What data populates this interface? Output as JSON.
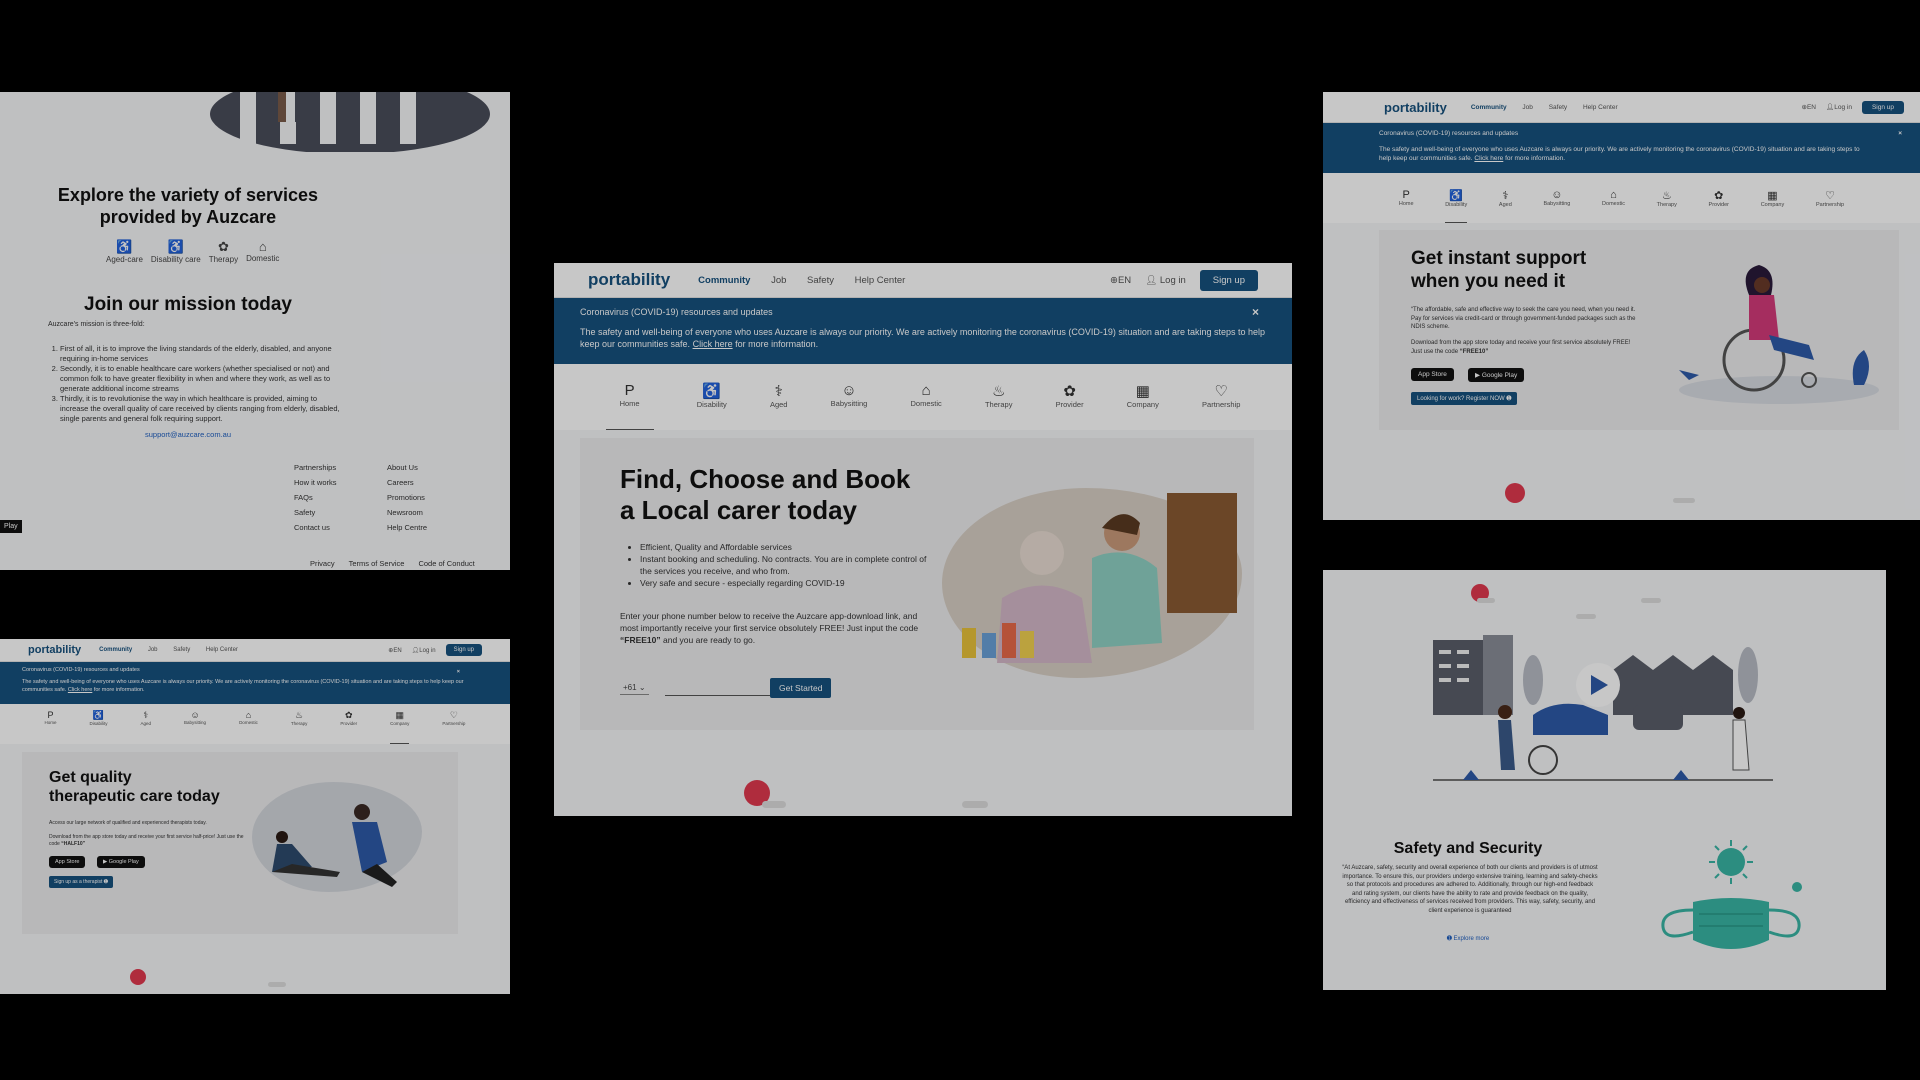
{
  "brand": "portability",
  "nav": [
    "Community",
    "Job",
    "Safety",
    "Help Center"
  ],
  "lang": "EN",
  "login": "Log in",
  "signup": "Sign up",
  "banner": {
    "title": "Coronavirus (COVID-19) resources and updates",
    "text": "The safety and well-being of everyone who uses Auzcare is always our priority. We are actively monitoring the coronavirus (COVID-19) situation and are taking steps to help keep our communities safe.",
    "link": "Click here",
    "tail": "for more information.",
    "close": "×"
  },
  "categories": [
    {
      "label": "Home",
      "icon": "P"
    },
    {
      "label": "Disability",
      "icon": "♿"
    },
    {
      "label": "Aged",
      "icon": "⚕"
    },
    {
      "label": "Babysitting",
      "icon": "☺"
    },
    {
      "label": "Domestic",
      "icon": "⌂"
    },
    {
      "label": "Therapy",
      "icon": "♨"
    },
    {
      "label": "Provider",
      "icon": "✿"
    },
    {
      "label": "Company",
      "icon": "▦"
    },
    {
      "label": "Partnership",
      "icon": "♡"
    }
  ],
  "center": {
    "title_line1": "Find, Choose and Book",
    "title_line2": "a Local carer today",
    "bullets": [
      "Efficient, Quality and Affordable services",
      "Instant booking and scheduling. No contracts. You are in complete control of the services you receive, and who from.",
      "Very safe and secure - especially regarding COVID-19"
    ],
    "para1": "Enter your phone number below to receive the Auzcare app-download link, and most importantly receive your first service obsolutely FREE! Just input the code",
    "code": "“FREE10”",
    "para2": "and you are ready to go.",
    "country_code": "+61",
    "cta": "Get Started"
  },
  "topleft": {
    "explore_line1": "Explore the variety of services",
    "explore_line2": "provided by Auzcare",
    "services": [
      "Aged-care",
      "Disability care",
      "Therapy",
      "Domestic"
    ],
    "mission_title": "Join our mission today",
    "mission_intro": "Auzcare's mission is three-fold:",
    "mission_items": [
      "First of all, it is to improve the living standards of the elderly, disabled, and anyone requiring in-home services",
      "Secondly, it is to enable healthcare care workers (whether specialised or not) and common folk to have greater flexibility in when and where they work, as well as to generate additional income streams",
      "Thirdly, it is to revolutionise the way in which healthcare is provided, aiming to increase the overall quality of care received by clients ranging from elderly, disabled, single parents and general folk requiring support."
    ],
    "email": "support@auzcare.com.au",
    "footer_col1": [
      "Partnerships",
      "How it works",
      "FAQs",
      "Safety",
      "Contact us"
    ],
    "footer_col2": [
      "About Us",
      "Careers",
      "Promotions",
      "Newsroom",
      "Help Centre"
    ],
    "legal": [
      "Privacy",
      "Terms of Service",
      "Code of Conduct"
    ],
    "edge_play": "Play"
  },
  "bottomleft": {
    "title_line1": "Get quality",
    "title_line2": "therapeutic care today",
    "text1": "Access our large network of qualified and experienced therapists today.",
    "text2": "Download from the app store today and receive your first service half-price! Just use the code",
    "code": "“HALF10”",
    "app_store": "App Store",
    "google_play": "Google Play",
    "cta": "Sign up as a therapist ➊"
  },
  "topright": {
    "title_line1": "Get instant support",
    "title_line2": "when you need it",
    "text1": "“The affordable, safe and effective way to seek the care you need, when you need it. Pay for services via credit-card or through government-funded packages such as the NDIS scheme.",
    "text2": "Download from the app store today and receive your first service absolutely FREE! Just use the code",
    "code": "“FREE10”",
    "app_store": "App Store",
    "google_play": "Google Play",
    "cta": "Looking for work? Register NOW ➊"
  },
  "bottomright": {
    "title": "Safety and Security",
    "text": "“At Auzcare, safety, security and overall experience of both our clients and providers is of utmost importance. To ensure this, our providers undergo extensive training, learning and safety-checks so that protocols and procedures are adhered to. Additionally, through our high-end feedback and rating system, our clients have the ability to rate and provide feedback on the quality, efficiency and effectiveness of services received from providers. This way, safety, security, and client experience is guaranteed",
    "link": "➊ Explore more"
  },
  "colors": {
    "brand": "#17517e",
    "accent_red": "#e0394f",
    "mask": "#39b5a4",
    "background": "#000000"
  }
}
